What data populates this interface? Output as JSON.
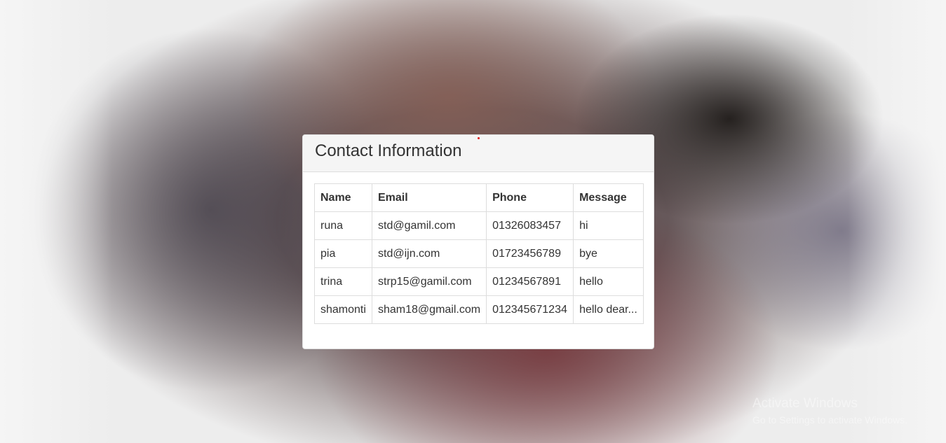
{
  "panel": {
    "title": "Contact Information"
  },
  "table": {
    "headers": [
      "Name",
      "Email",
      "Phone",
      "Message"
    ],
    "rows": [
      [
        "runa",
        "std@gamil.com",
        "01326083457",
        "hi"
      ],
      [
        "pia",
        "std@ijn.com",
        "01723456789",
        "bye"
      ],
      [
        "trina",
        "strp15@gamil.com",
        "01234567891",
        "hello"
      ],
      [
        "shamonti",
        "sham18@gmail.com",
        "012345671234",
        "hello dear..."
      ]
    ]
  },
  "watermark": {
    "title": "Activate Windows",
    "subtitle": "Go to Settings to activate Windows."
  }
}
